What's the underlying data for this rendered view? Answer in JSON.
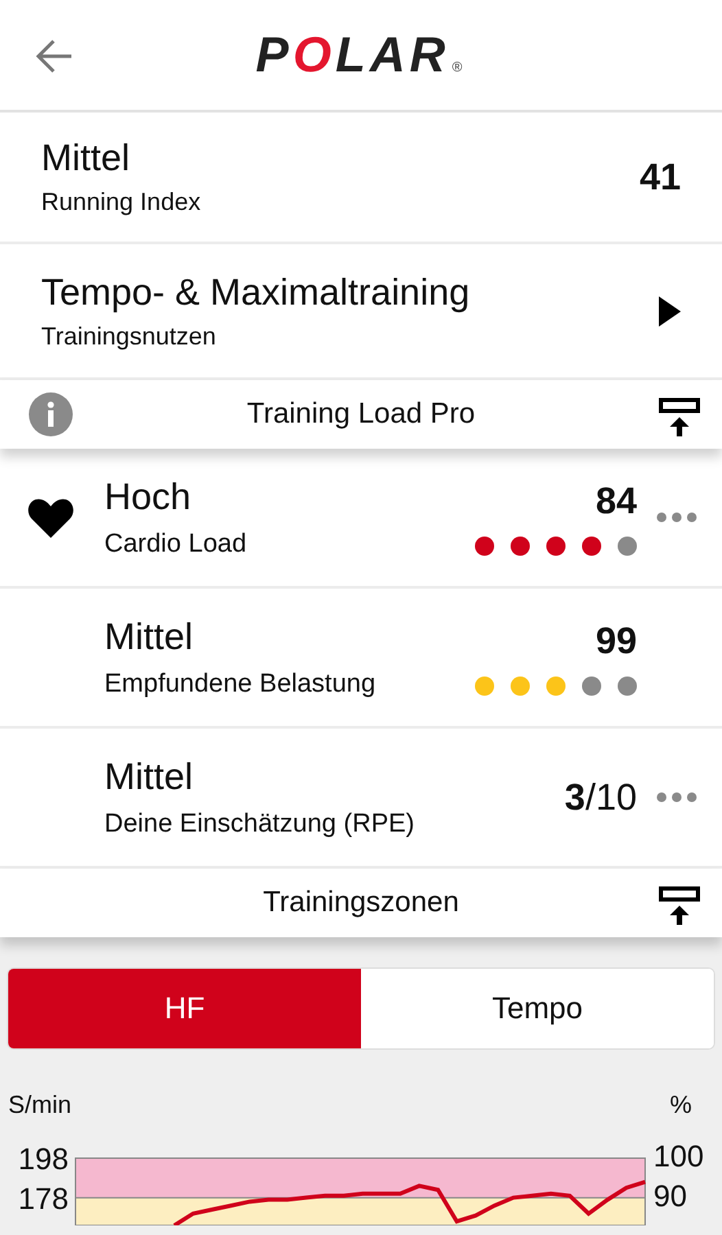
{
  "header": {
    "logo": "POLAR",
    "registered": "®"
  },
  "summary_rows": [
    {
      "title": "Mittel",
      "subtitle": "Running Index",
      "value": "41",
      "chevron": false
    },
    {
      "title": "Tempo- & Maximaltraining",
      "subtitle": "Trainingsnutzen",
      "value": "",
      "chevron": true
    }
  ],
  "training_load": {
    "title": "Training Load Pro",
    "rows": [
      {
        "title": "Hoch",
        "subtitle": "Cardio Load",
        "kind": "score",
        "value": "84",
        "stars": 4,
        "color": "#d0021b",
        "menu": true
      },
      {
        "title": "Mittel",
        "subtitle": "Empfundene Belastung",
        "kind": "score",
        "value": "99",
        "stars": 3,
        "color": "#fcc419",
        "menu": false
      },
      {
        "title": "Mittel",
        "subtitle": "Deine Einschätzung (RPE)",
        "kind": "rating",
        "value": "**3**/10",
        "menu": true
      }
    ]
  },
  "zones": {
    "title": "Trainingszonen",
    "tabs": [
      {
        "label": "HF",
        "selected": true
      },
      {
        "label": "Tempo",
        "selected": false
      }
    ],
    "right_label": "%",
    "right_ticks": [
      "100",
      "90"
    ],
    "chart_data": {
      "type": "line",
      "ylabel": "S/min",
      "ylim": [
        164,
        198
      ],
      "yticks": [
        178,
        198
      ],
      "series": [
        {
          "color": "#d0021b",
          "values": [
            164,
            170,
            172,
            174,
            176,
            177,
            177,
            178,
            179,
            179,
            180,
            180,
            180,
            184,
            182,
            166,
            169,
            174,
            178,
            179,
            180,
            179,
            170,
            177,
            183,
            186
          ]
        }
      ],
      "bands": [
        {
          "axis": "y",
          "from": 178,
          "to": 198,
          "color": "#f5b8cf"
        },
        {
          "axis": "y",
          "from": 164,
          "to": 178,
          "color": "#fdeec1"
        }
      ]
    }
  }
}
